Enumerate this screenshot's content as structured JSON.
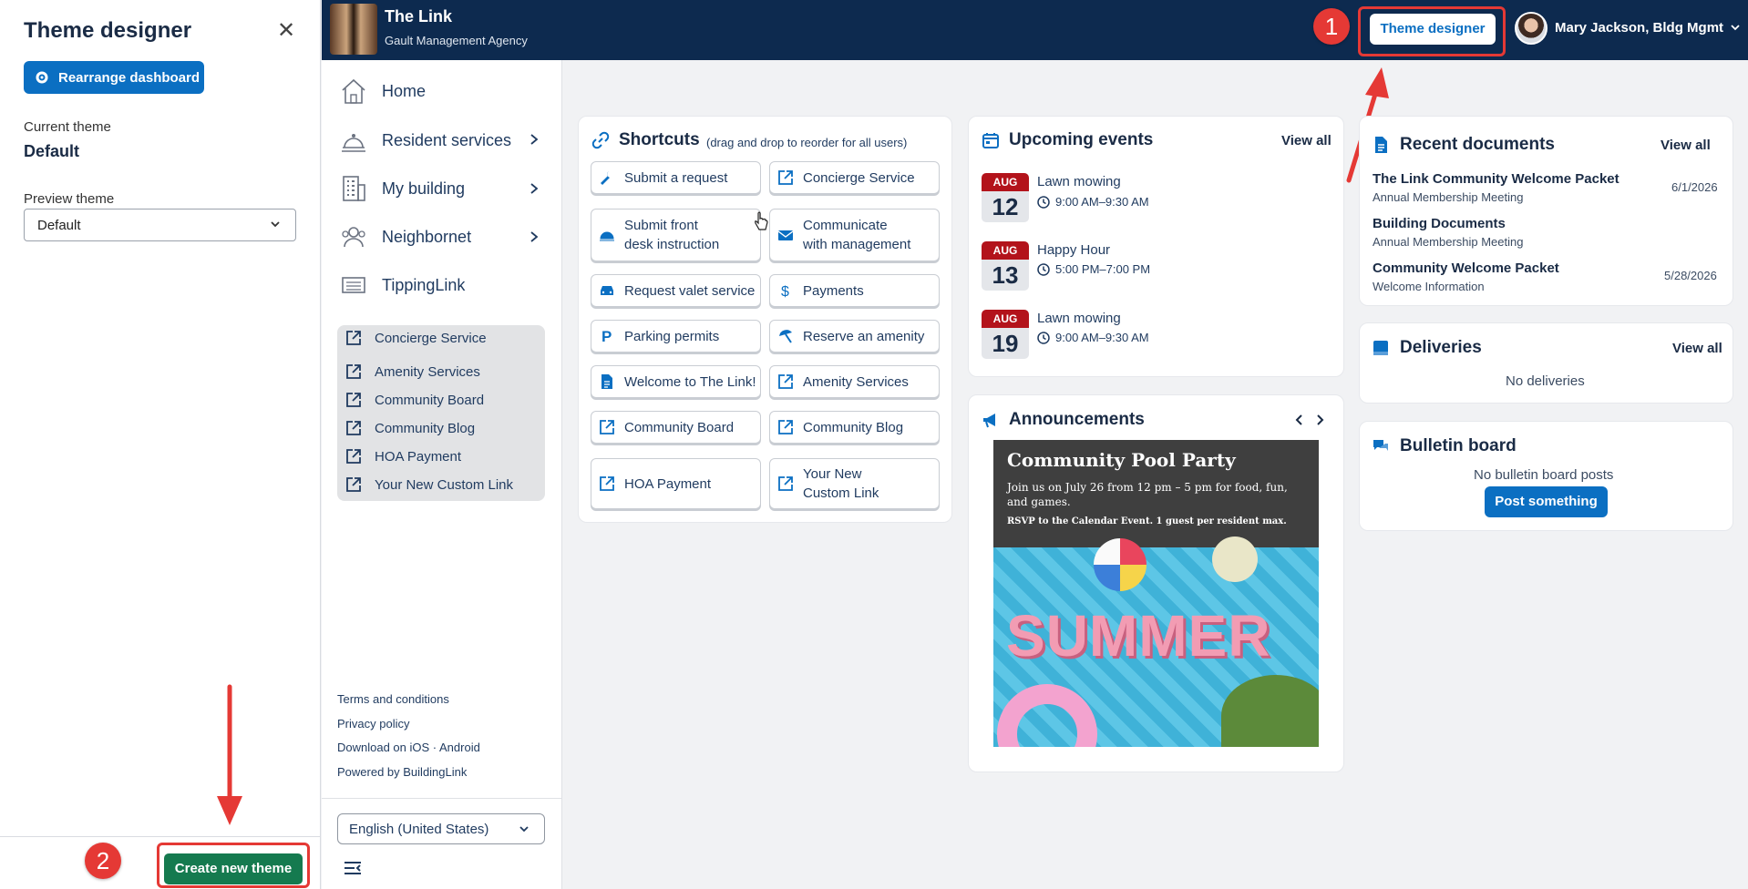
{
  "theme_designer": {
    "title": "Theme designer",
    "rearrange_label": "Rearrange dashboard",
    "current_theme_label": "Current theme",
    "current_theme_value": "Default",
    "preview_theme_label": "Preview theme",
    "preview_theme_value": "Default",
    "create_label": "Create new theme"
  },
  "header": {
    "title": "The Link",
    "subtitle": "Gault Management Agency",
    "theme_designer_label": "Theme designer",
    "user_name": "Mary Jackson, Bldg Mgmt"
  },
  "annotations": {
    "badge1": "1",
    "badge2": "2",
    "color": "#e53935"
  },
  "nav": {
    "items": [
      {
        "label": "Home",
        "icon": "home-icon"
      },
      {
        "label": "Resident services",
        "icon": "service-bell-icon"
      },
      {
        "label": "My building",
        "icon": "building-icon"
      },
      {
        "label": "Neighbornet",
        "icon": "people-icon"
      },
      {
        "label": "TippingLink",
        "icon": "list-icon"
      }
    ],
    "links": [
      "Concierge Service",
      "Amenity Services",
      "Community Board",
      "Community Blog",
      "HOA Payment",
      "Your New Custom Link"
    ],
    "footer": [
      "Terms and conditions",
      "Privacy policy",
      "Download on iOS · Android",
      "Powered by BuildingLink"
    ],
    "language": "English (United States)"
  },
  "shortcuts": {
    "title": "Shortcuts",
    "hint": "(drag and drop to reorder for all users)",
    "items": [
      {
        "label": "Submit a request",
        "icon": "wrench-icon"
      },
      {
        "label": "Concierge Service",
        "icon": "external-link-icon"
      },
      {
        "label": "Submit front desk instruction",
        "line1": "Submit front",
        "line2": "desk instruction",
        "icon": "service-bell-icon"
      },
      {
        "label": "Communicate with management",
        "line1": "Communicate",
        "line2": "with management",
        "icon": "envelope-icon"
      },
      {
        "label": "Request valet service",
        "icon": "car-icon"
      },
      {
        "label": "Payments",
        "icon": "dollar-icon"
      },
      {
        "label": "Parking permits",
        "icon": "parking-icon"
      },
      {
        "label": "Reserve an amenity",
        "icon": "umbrella-icon"
      },
      {
        "label": "Welcome to The Link!",
        "icon": "document-icon"
      },
      {
        "label": "Amenity Services",
        "icon": "external-link-icon"
      },
      {
        "label": "Community Board",
        "icon": "external-link-icon"
      },
      {
        "label": "Community Blog",
        "icon": "external-link-icon"
      },
      {
        "label": "HOA Payment",
        "icon": "external-link-icon"
      },
      {
        "label": "Your New Custom Link",
        "line1": "Your New",
        "line2": "Custom Link",
        "icon": "external-link-icon"
      }
    ]
  },
  "events": {
    "title": "Upcoming events",
    "view_all": "View all",
    "items": [
      {
        "month": "AUG",
        "day": "12",
        "name": "Lawn mowing",
        "time": "9:00 AM–9:30 AM"
      },
      {
        "month": "AUG",
        "day": "13",
        "name": "Happy Hour",
        "time": "5:00 PM–7:00 PM"
      },
      {
        "month": "AUG",
        "day": "19",
        "name": "Lawn mowing",
        "time": "9:00 AM–9:30 AM"
      }
    ]
  },
  "announcements": {
    "title": "Announcements",
    "heading": "Community Pool Party",
    "body": "Join us on July 26 from 12 pm – 5 pm for food, fun, and games.",
    "rsvp": "RSVP to the Calendar Event. 1 guest per resident max.",
    "image_text": "SUMMER"
  },
  "documents": {
    "title": "Recent documents",
    "view_all": "View all",
    "items": [
      {
        "title": "The Link Community Welcome Packet",
        "sub": "Annual Membership Meeting",
        "date": "6/1/2026"
      },
      {
        "title": "Building Documents",
        "sub": "Annual Membership Meeting",
        "date": ""
      },
      {
        "title": "Community Welcome Packet",
        "sub": "Welcome Information",
        "date": "5/28/2026"
      }
    ]
  },
  "deliveries": {
    "title": "Deliveries",
    "view_all": "View all",
    "empty": "No deliveries"
  },
  "bulletin": {
    "title": "Bulletin board",
    "empty": "No bulletin board posts",
    "post_label": "Post something"
  },
  "colors": {
    "primary": "#0b6fc2",
    "header": "#0d2a4f",
    "create": "#157a4f",
    "event_month": "#b3131b"
  }
}
